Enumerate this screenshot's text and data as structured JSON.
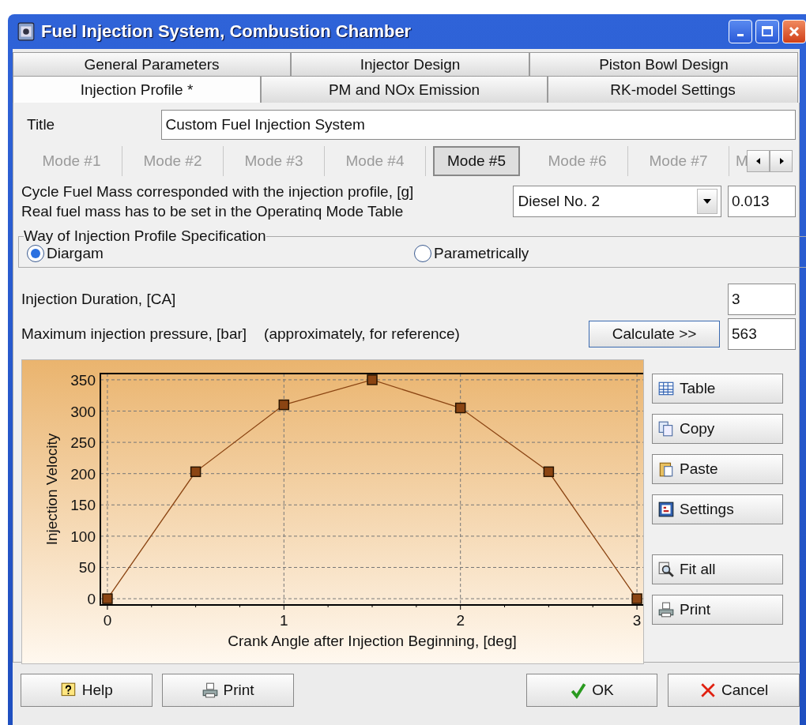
{
  "window": {
    "title": "Fuel Injection System, Combustion Chamber"
  },
  "tab_rows": [
    [
      {
        "label": "General Parameters",
        "selected": false
      },
      {
        "label": "Injector Design",
        "selected": false
      },
      {
        "label": "Piston Bowl Design",
        "selected": false
      }
    ],
    [
      {
        "label": "Injection Profile *",
        "selected": true
      },
      {
        "label": "PM and NOx Emission",
        "selected": false
      },
      {
        "label": "RK-model Settings",
        "selected": false
      }
    ]
  ],
  "title_field": {
    "label": "Title",
    "value": "Custom Fuel Injection System"
  },
  "modes": [
    {
      "label": "Mode #1",
      "selected": false
    },
    {
      "label": "Mode #2",
      "selected": false
    },
    {
      "label": "Mode #3",
      "selected": false
    },
    {
      "label": "Mode #4",
      "selected": false
    },
    {
      "label": "Mode #5",
      "selected": true
    },
    {
      "label": "Mode #6",
      "selected": false
    },
    {
      "label": "Mode #7",
      "selected": false
    },
    {
      "label": "M",
      "selected": false
    }
  ],
  "fuel": {
    "lines": [
      "Cycle Fuel Mass corresponded with the injection profile, [g]",
      "Real fuel mass has to be set in the Operatinq Mode Table"
    ],
    "fuel_type": "Diesel No. 2",
    "mass": "0.013"
  },
  "specification": {
    "title": "Way of Injection Profile Specification",
    "options": [
      {
        "label": "Diargam",
        "selected": true
      },
      {
        "label": "Parametrically",
        "selected": false
      }
    ]
  },
  "duration": {
    "label": "Injection Duration, [CA]",
    "value": "3"
  },
  "pressure": {
    "label": "Maximum injection pressure, [bar]",
    "note": "(approximately, for reference)",
    "button": "Calculate >>",
    "value": "563"
  },
  "chart_data": {
    "type": "line",
    "xlabel": "Crank Angle after Injection Beginning, [deg]",
    "ylabel": "Injection Velocity",
    "x": [
      0,
      0.5,
      1,
      1.5,
      2,
      2.5,
      3
    ],
    "series": [
      {
        "color": "#8b4513",
        "marker": "square",
        "values": [
          0,
          203,
          310,
          350,
          305,
          203,
          0
        ]
      }
    ],
    "grid": true,
    "xlim": [
      -0.04,
      3.04
    ],
    "ylim": [
      -10,
      360
    ],
    "xticks": [
      0,
      1,
      2,
      3
    ],
    "yticks": [
      0,
      50,
      100,
      150,
      200,
      250,
      300,
      350
    ]
  },
  "side_buttons": [
    {
      "kind": "table",
      "label": "Table"
    },
    {
      "kind": "copy",
      "label": "Copy"
    },
    {
      "kind": "paste",
      "label": "Paste"
    },
    {
      "kind": "settings",
      "label": "Settings"
    },
    {
      "kind": "fit",
      "label": "Fit all"
    },
    {
      "kind": "print",
      "label": "Print"
    }
  ],
  "bottom_buttons": [
    {
      "kind": "help",
      "label": "Help"
    },
    {
      "kind": "print",
      "label": "Print"
    },
    {
      "kind": "ok",
      "label": "OK"
    },
    {
      "kind": "cancel",
      "label": "Cancel"
    }
  ]
}
